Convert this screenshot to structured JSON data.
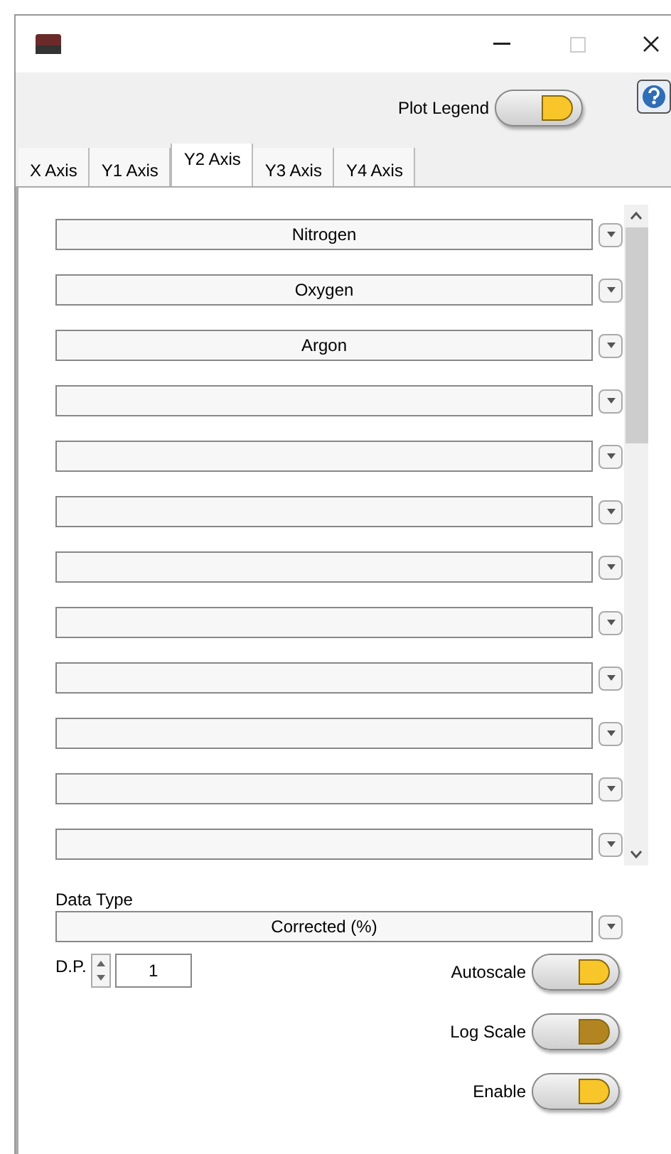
{
  "plot_legend": {
    "label": "Plot Legend",
    "on": true
  },
  "tabs": [
    {
      "label": "X Axis",
      "selected": false
    },
    {
      "label": "Y1 Axis",
      "selected": false
    },
    {
      "label": "Y2 Axis",
      "selected": true
    },
    {
      "label": "Y3 Axis",
      "selected": false
    },
    {
      "label": "Y4 Axis",
      "selected": false
    }
  ],
  "channels": [
    {
      "kind": "filled",
      "value": "Nitrogen"
    },
    {
      "kind": "filled",
      "value": "Oxygen"
    },
    {
      "kind": "filled",
      "value": "Argon"
    },
    {
      "kind": "empty"
    },
    {
      "kind": "empty"
    },
    {
      "kind": "empty"
    },
    {
      "kind": "empty"
    },
    {
      "kind": "empty"
    },
    {
      "kind": "empty"
    },
    {
      "kind": "empty"
    },
    {
      "kind": "empty"
    },
    {
      "kind": "empty"
    }
  ],
  "data_type": {
    "label": "Data Type",
    "value": "Corrected (%)"
  },
  "decimal_places": {
    "label": "D.P.",
    "value": "1"
  },
  "toggles": [
    {
      "label": "Autoscale",
      "on": true,
      "disabled": false
    },
    {
      "label": "Log Scale",
      "on": true,
      "disabled": true
    },
    {
      "label": "Enable",
      "on": true,
      "disabled": false
    }
  ]
}
